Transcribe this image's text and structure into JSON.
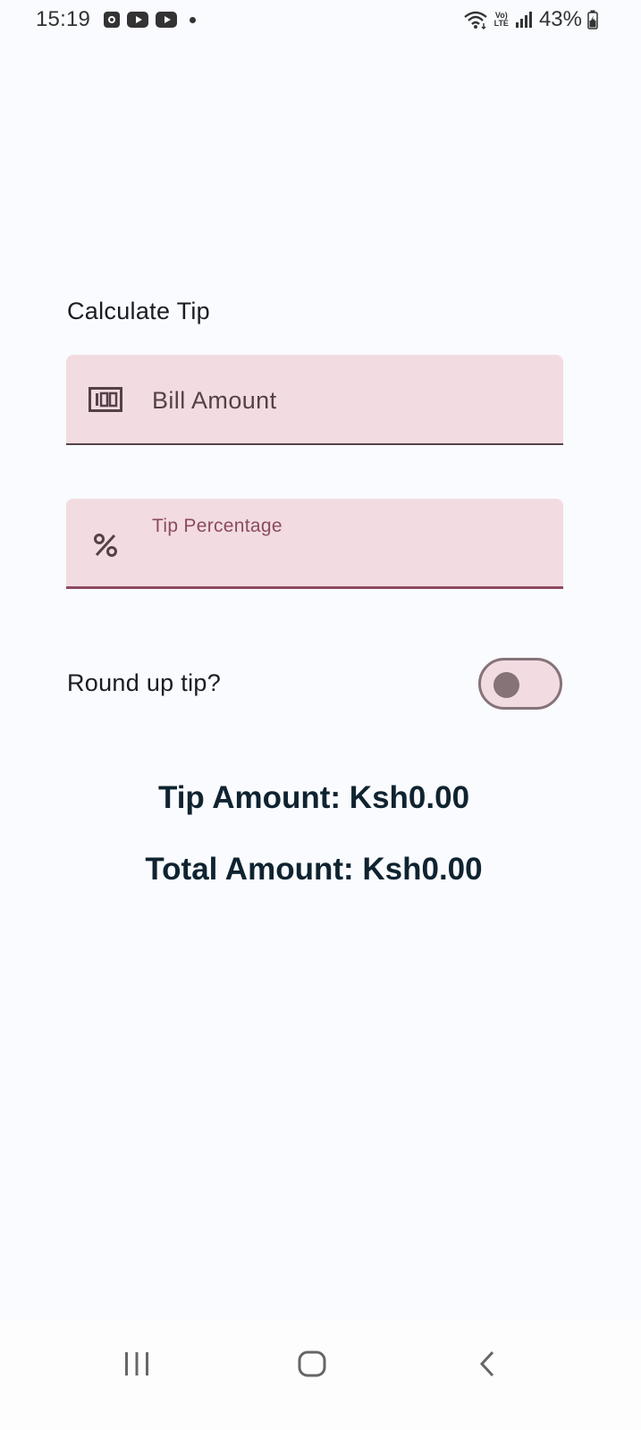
{
  "status_bar": {
    "time": "15:19",
    "battery": "43%",
    "network": "LTE",
    "icons": [
      "clock-notification-icon",
      "youtube-icon",
      "youtube-icon",
      "dot-icon",
      "wifi-icon",
      "volte-icon",
      "signal-icon",
      "battery-icon"
    ]
  },
  "app": {
    "heading": "Calculate Tip",
    "bill_field": {
      "placeholder": "Bill Amount",
      "value": "",
      "icon": "money-icon"
    },
    "tip_field": {
      "label": "Tip Percentage",
      "value": "",
      "icon": "percent-icon"
    },
    "round_up": {
      "label": "Round up tip?",
      "checked": false
    },
    "tip_amount": "Tip Amount: Ksh0.00",
    "total_amount": "Total Amount: Ksh0.00"
  },
  "colors": {
    "background": "#f9fbfe",
    "field_fill": "#f2dce1",
    "accent": "#8c4a60",
    "on_surface_variant": "#544147",
    "outline": "#857378",
    "result_text": "#0f2330"
  },
  "nav_bar": {
    "buttons": [
      "recent-apps-icon",
      "home-icon",
      "back-icon"
    ]
  }
}
